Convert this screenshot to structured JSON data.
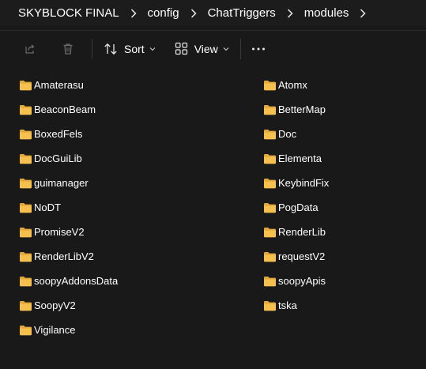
{
  "breadcrumb": [
    "SKYBLOCK FINAL",
    "config",
    "ChatTriggers",
    "modules"
  ],
  "toolbar": {
    "sort_label": "Sort",
    "view_label": "View",
    "more_label": "···"
  },
  "colors": {
    "background": "#191919",
    "folder": "#f5c04e",
    "text": "#ffffff",
    "disabled_icon": "#6b6b6b"
  },
  "folders_left": [
    "Amaterasu",
    "BeaconBeam",
    "BoxedFels",
    "DocGuiLib",
    "guimanager",
    "NoDT",
    "PromiseV2",
    "RenderLibV2",
    "soopyAddonsData",
    "SoopyV2",
    "Vigilance"
  ],
  "folders_right": [
    "Atomx",
    "BetterMap",
    "Doc",
    "Elementa",
    "KeybindFix",
    "PogData",
    "RenderLib",
    "requestV2",
    "soopyApis",
    "tska"
  ],
  "icons": {
    "share": "share-icon",
    "delete": "trash-icon",
    "sort": "sort-icon",
    "view": "view-grid-icon",
    "more": "more-icon",
    "folder": "folder-icon",
    "chevron": "chevron-right-icon"
  }
}
